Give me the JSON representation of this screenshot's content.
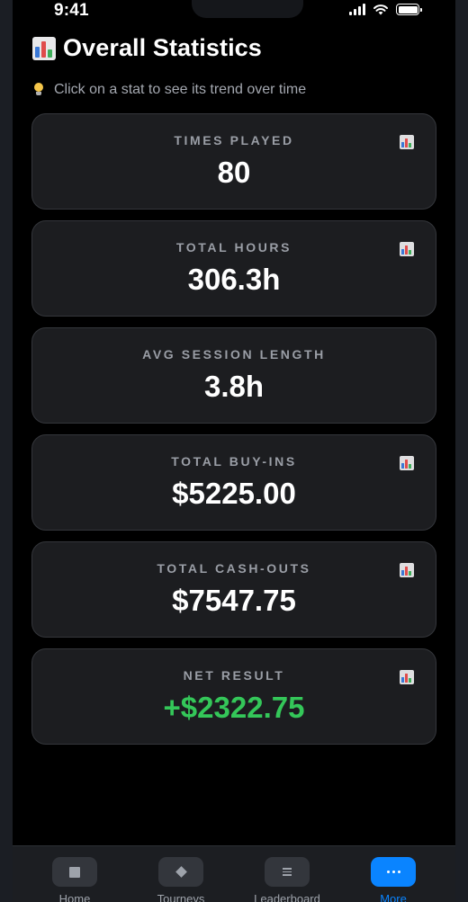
{
  "status_bar": {
    "time": "9:41"
  },
  "header": {
    "title": "Overall Statistics",
    "icon": "bar-chart-emoji"
  },
  "hint": {
    "icon": "lightbulb-emoji",
    "text": "Click on a stat to see its trend over time"
  },
  "stats": [
    {
      "label": "TIMES PLAYED",
      "value": "80",
      "has_trend": true,
      "value_color": "#ffffff"
    },
    {
      "label": "TOTAL HOURS",
      "value": "306.3h",
      "has_trend": true,
      "value_color": "#ffffff"
    },
    {
      "label": "AVG SESSION LENGTH",
      "value": "3.8h",
      "has_trend": false,
      "value_color": "#ffffff"
    },
    {
      "label": "TOTAL BUY-INS",
      "value": "$5225.00",
      "has_trend": true,
      "value_color": "#ffffff"
    },
    {
      "label": "TOTAL CASH-OUTS",
      "value": "$7547.75",
      "has_trend": true,
      "value_color": "#ffffff"
    },
    {
      "label": "NET RESULT",
      "value": "+$2322.75",
      "has_trend": true,
      "value_color": "#34c759"
    }
  ],
  "tabs": [
    {
      "label": "Home",
      "icon": "square-icon",
      "active": false
    },
    {
      "label": "Tourneys",
      "icon": "diamond-icon",
      "active": false
    },
    {
      "label": "Leaderboard",
      "icon": "list-icon",
      "active": false
    },
    {
      "label": "More",
      "icon": "more-dots-icon",
      "active": true
    }
  ],
  "colors": {
    "accent": "#0a84ff",
    "positive": "#34c759",
    "card_bg": "#1c1d20",
    "background": "#000000"
  }
}
